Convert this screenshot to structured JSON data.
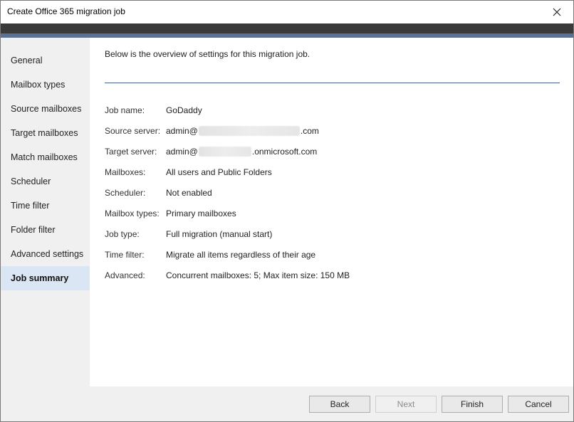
{
  "window": {
    "title": "Create Office 365 migration job"
  },
  "sidebar": {
    "items": [
      {
        "label": "General"
      },
      {
        "label": "Mailbox types"
      },
      {
        "label": "Source mailboxes"
      },
      {
        "label": "Target mailboxes"
      },
      {
        "label": "Match mailboxes"
      },
      {
        "label": "Scheduler"
      },
      {
        "label": "Time filter"
      },
      {
        "label": "Folder filter"
      },
      {
        "label": "Advanced settings"
      },
      {
        "label": "Job summary",
        "active": true
      }
    ]
  },
  "summary": {
    "intro": "Below is the overview of settings for this migration job.",
    "job_name": {
      "label": "Job name:",
      "value": "GoDaddy"
    },
    "source_server": {
      "label": "Source server:",
      "prefix": "admin@",
      "suffix": ".com"
    },
    "target_server": {
      "label": "Target server:",
      "prefix": "admin@",
      "suffix": ".onmicrosoft.com"
    },
    "mailboxes": {
      "label": "Mailboxes:",
      "value": "All users and Public Folders"
    },
    "scheduler": {
      "label": "Scheduler:",
      "value": "Not enabled"
    },
    "mailbox_types": {
      "label": "Mailbox types:",
      "value": "Primary mailboxes"
    },
    "job_type": {
      "label": "Job type:",
      "value": "Full migration (manual start)"
    },
    "time_filter": {
      "label": "Time filter:",
      "value": "Migrate all items regardless of their age"
    },
    "advanced": {
      "label": "Advanced:",
      "value": "Concurrent mailboxes: 5; Max item size: 150 MB"
    }
  },
  "footer": {
    "back": "Back",
    "next": "Next",
    "finish": "Finish",
    "cancel": "Cancel"
  },
  "colors": {
    "accent_band": "#5a7195",
    "active_nav": "#dbe6f4",
    "divider": "#45608a"
  }
}
